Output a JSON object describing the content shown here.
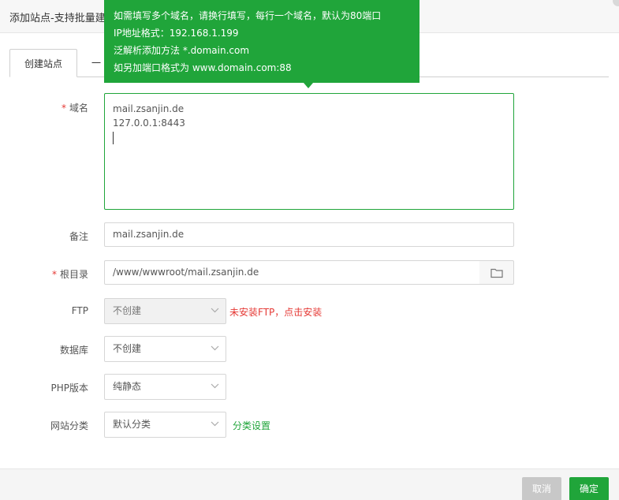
{
  "window": {
    "title": "添加站点-支持批量建站"
  },
  "tabs": [
    {
      "label": "创建站点",
      "active": true
    },
    {
      "label": "一"
    }
  ],
  "tooltip": {
    "lines": [
      "如需填写多个域名，请换行填写，每行一个域名，默认为80端口",
      "IP地址格式：192.168.1.199",
      "泛解析添加方法 *.domain.com",
      "如另加端口格式为 www.domain.com:88"
    ]
  },
  "form": {
    "domain": {
      "required_mark": "*",
      "label": "域名",
      "lines": [
        "mail.zsanjin.de",
        "127.0.0.1:8443"
      ]
    },
    "remark": {
      "label": "备注",
      "value": "mail.zsanjin.de"
    },
    "root": {
      "required_mark": "*",
      "label": "根目录",
      "value": "/www/wwwroot/mail.zsanjin.de"
    },
    "ftp": {
      "label": "FTP",
      "value": "不创建",
      "warning": "未安装FTP，点击安装"
    },
    "database": {
      "label": "数据库",
      "value": "不创建"
    },
    "php": {
      "label": "PHP版本",
      "value": "纯静态"
    },
    "category": {
      "label": "网站分类",
      "value": "默认分类",
      "link": "分类设置"
    }
  },
  "footer": {
    "cancel_label": "取消",
    "ok_label": "确定"
  },
  "colors": {
    "accent": "#20a53a",
    "danger": "#e53935",
    "disabled_button": "#c8c8c8"
  }
}
